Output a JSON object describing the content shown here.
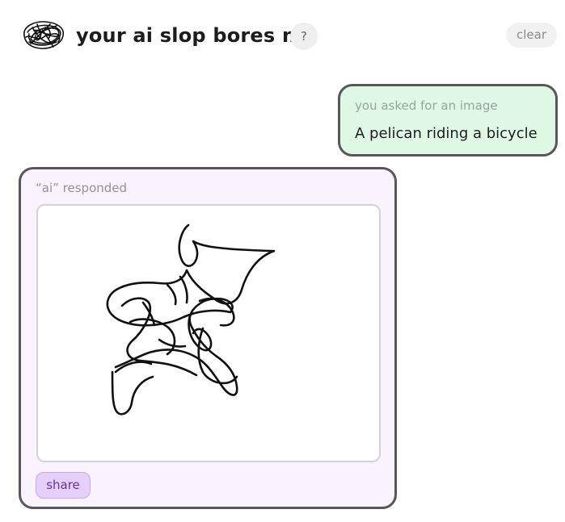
{
  "header": {
    "logo_icon": "scribble-logo-icon",
    "title": "your ai slop bores me",
    "help_label": "?",
    "clear_label": "clear"
  },
  "request": {
    "label": "you asked for an image",
    "prompt": "A pelican riding a bicycle",
    "background_color": "#dff8e5"
  },
  "response": {
    "label": "“ai” responded",
    "drawing_icon": "scribble-drawing",
    "share_label": "share",
    "background_color": "#f8f3fd",
    "share_color": "#e4d0fb"
  }
}
